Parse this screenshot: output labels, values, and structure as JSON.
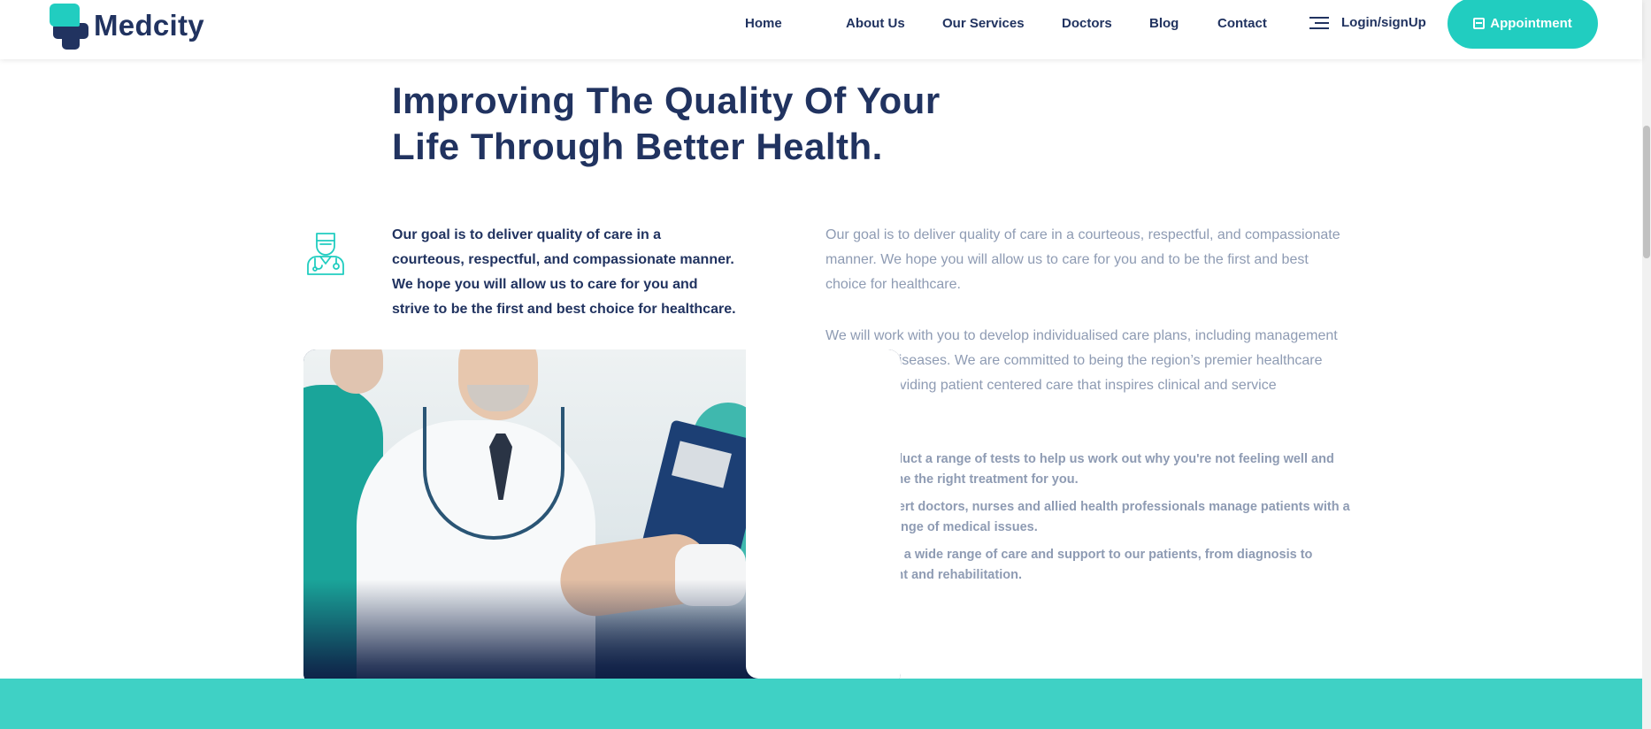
{
  "brand": {
    "name": "Medcity",
    "accent": "#21cdc0",
    "primary": "#213360",
    "muted": "#8e9bb3"
  },
  "nav": {
    "items": [
      {
        "label": "Home"
      },
      {
        "label": "About Us"
      },
      {
        "label": "Our Services"
      },
      {
        "label": "Doctors"
      },
      {
        "label": "Blog"
      },
      {
        "label": "Contact"
      }
    ],
    "login": {
      "label": "Login/signUp",
      "icon": "menu-icon"
    },
    "appointment": {
      "label": "Appointment",
      "icon": "calendar-icon"
    }
  },
  "main": {
    "heading_line1": "Improving The Quality Of Your",
    "heading_line2": "Life Through Better Health.",
    "intro": "Our goal is to deliver quality of care in a courteous, respectful, and compassionate manner. We hope you will allow us to care for you and strive to be the first and best choice for healthcare.",
    "intro_icon": "doctor-icon",
    "para1": "Our goal is to deliver quality of care in a courteous, respectful, and compassionate manner. We hope you will allow us to care for you and to be the first and best choice for healthcare.",
    "para2": "We will work with you to develop individualised care plans, including management of chronic diseases. We are committed to being the region’s premier healthcare network providing patient centered care that inspires clinical and service excellence.",
    "bullets": [
      "We conduct a range of tests to help us work out why you're not feeling well and determine the right treatment for you.",
      "Our expert doctors, nurses and allied health professionals manage patients with a broad range of medical issues.",
      "We offer a wide range of care and support to our patients, from diagnosis to treatment and rehabilitation."
    ]
  }
}
